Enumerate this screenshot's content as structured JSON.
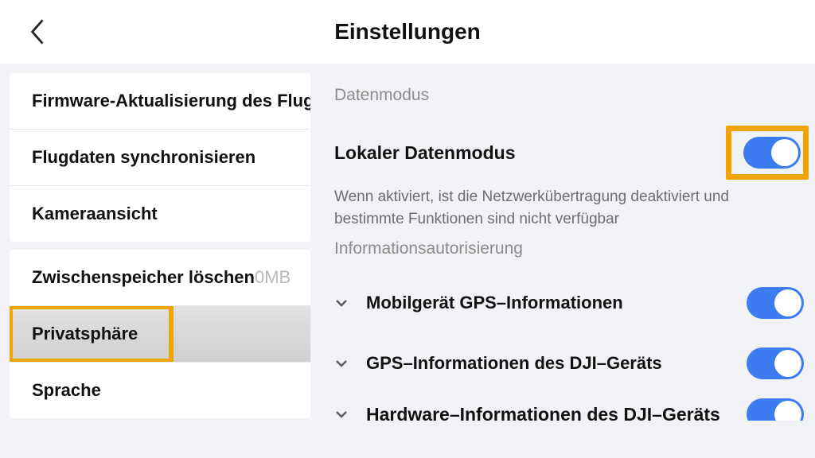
{
  "header": {
    "title": "Einstellungen"
  },
  "sidebar": {
    "group1": [
      {
        "label": "Firmware-Aktualisierung des Flug",
        "value": ""
      },
      {
        "label": "Flugdaten synchronisieren",
        "value": ""
      },
      {
        "label": "Kameraansicht",
        "value": ""
      }
    ],
    "group2": [
      {
        "label": "Zwischenspeicher löschen",
        "value": "0MB"
      },
      {
        "label": "Privatsphäre",
        "value": ""
      },
      {
        "label": "Sprache",
        "value": ""
      }
    ]
  },
  "main": {
    "section1_header": "Datenmodus",
    "local_data_mode": {
      "label": "Lokaler Datenmodus",
      "desc": "Wenn aktiviert, ist die Netzwerkübertragung deaktiviert und bestimmte Funktionen sind nicht verfügbar"
    },
    "section2_header": "Informationsautorisierung",
    "auth_items": [
      {
        "label": "Mobilgerät GPS–Informationen"
      },
      {
        "label": "GPS–Informationen des DJI–Geräts"
      },
      {
        "label": "Hardware–Informationen des DJI–Geräts"
      }
    ]
  }
}
